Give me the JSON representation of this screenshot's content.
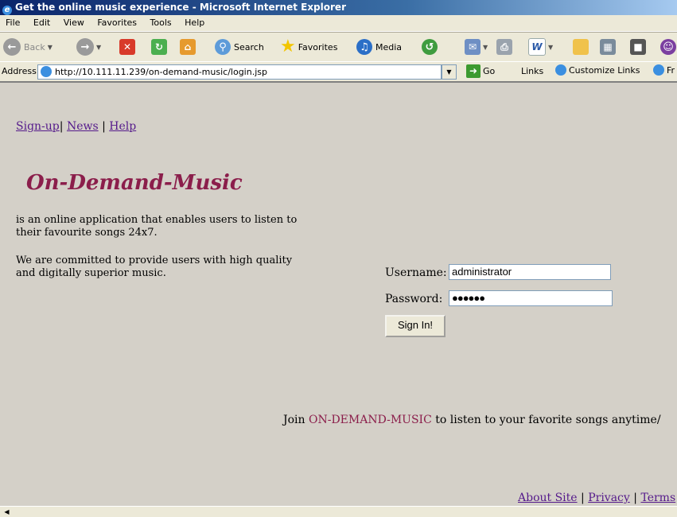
{
  "window": {
    "title": "Get the online music experience - Microsoft Internet Explorer"
  },
  "menu": [
    "File",
    "Edit",
    "View",
    "Favorites",
    "Tools",
    "Help"
  ],
  "toolbar": {
    "back": "Back",
    "search": "Search",
    "favorites": "Favorites",
    "media": "Media"
  },
  "address": {
    "label": "Address",
    "url": "http://10.111.11.239/on-demand-music/login.jsp",
    "go": "Go",
    "links": "Links",
    "customize": "Customize Links",
    "fr": "Fr"
  },
  "page": {
    "nav": {
      "signup": "Sign-up",
      "sep1": "| ",
      "news": "News",
      "sep2": " | ",
      "help": "Help"
    },
    "brand": "On-Demand-Music",
    "desc1": "is an online application that enables users to listen to their favourite songs 24x7.",
    "desc2": "We are committed to provide users with high quality and digitally superior music.",
    "login": {
      "username_label": "Username:",
      "username_value": "administrator",
      "password_label": "Password:",
      "password_value": "●●●●●●",
      "button": "Sign In!"
    },
    "join": {
      "pre": "Join ",
      "name": "ON-DEMAND-MUSIC",
      "post": " to listen to your favorite songs anytime/"
    },
    "footer": {
      "about": "About Site",
      "sep1": " | ",
      "privacy": "Privacy",
      "sep2": " | ",
      "terms": "Terms"
    }
  }
}
